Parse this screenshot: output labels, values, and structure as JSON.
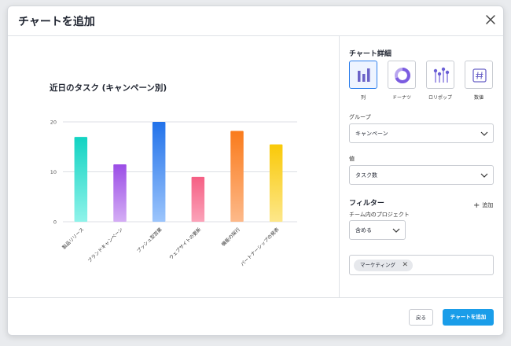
{
  "dialog": {
    "title": "チャートを追加"
  },
  "chart_data": {
    "type": "bar",
    "title": "近日のタスク (キャンペーン別)",
    "categories": [
      "製品リリース",
      "ブランドキャンペーン",
      "プッシュ型営業",
      "ウェブサイトの更新",
      "機能の採行",
      "パートナーシップの発表"
    ],
    "values": [
      17,
      11.5,
      20,
      9,
      18.2,
      15.5
    ],
    "yticks": [
      "0",
      "10",
      "20"
    ],
    "ylim": [
      0,
      23
    ],
    "grid": true,
    "colors": [
      [
        "#12d3c2",
        "#8ff3ea"
      ],
      [
        "#9b4de6",
        "#d4adf5"
      ],
      [
        "#2272ea",
        "#9cc5fc"
      ],
      [
        "#f55f84",
        "#fba3b9"
      ],
      [
        "#fa7b1c",
        "#fdb98a"
      ],
      [
        "#f9c908",
        "#fde78a"
      ]
    ]
  },
  "details": {
    "title": "チャート詳細",
    "types": [
      {
        "label": "列",
        "icon": "column-chart-icon",
        "selected": true
      },
      {
        "label": "ドーナツ",
        "icon": "donut-chart-icon",
        "selected": false
      },
      {
        "label": "ロリポップ",
        "icon": "lollipop-chart-icon",
        "selected": false
      },
      {
        "label": "数値",
        "icon": "number-icon",
        "selected": false
      }
    ],
    "group_label": "グループ",
    "group_value": "キャンペーン",
    "value_label": "値",
    "value_value": "タスク数",
    "filter_title": "フィルター",
    "filter_add": "追加",
    "filter_label": "チーム内のプロジェクト",
    "filter_op": "含める",
    "filter_tag": "マーケティング"
  },
  "footer": {
    "back_label": "戻る",
    "add_label": "チャートを追加"
  },
  "accent": "#1a9de9"
}
